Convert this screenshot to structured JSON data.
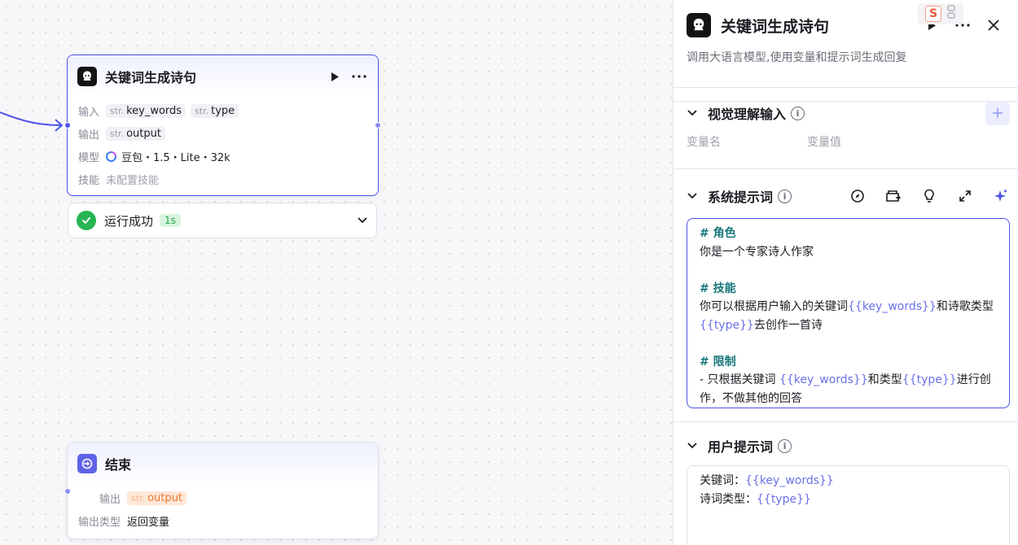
{
  "canvas": {
    "llm_node": {
      "title": "关键词生成诗句",
      "input_label": "输入",
      "inputs": [
        {
          "type": "str.",
          "name": "key_words"
        },
        {
          "type": "str.",
          "name": "type"
        }
      ],
      "output_label": "输出",
      "outputs": [
        {
          "type": "str.",
          "name": "output"
        }
      ],
      "model_label": "模型",
      "model_value": "豆包・1.5・Lite・32k",
      "skill_label": "技能",
      "skill_value": "未配置技能",
      "icons": {
        "node": "robot-icon",
        "run": "play-icon",
        "more": "more-icon"
      }
    },
    "run_status": {
      "text": "运行成功",
      "time": "1s",
      "color": "#27b553"
    },
    "end_node": {
      "title": "结束",
      "output_label": "输出",
      "output": {
        "type": "str.",
        "name": "output"
      },
      "output_type_label": "输出类型",
      "output_type_value": "返回变量",
      "icons": {
        "node": "exit-icon"
      }
    }
  },
  "panel": {
    "title": "关键词生成诗句",
    "description": "调用大语言模型,使用变量和提示词生成回复",
    "extension_badge": "S",
    "sections": {
      "vision": {
        "title": "视觉理解输入",
        "col_name": "变量名",
        "col_value": "变量值"
      },
      "system_prompt": {
        "title": "系统提示词",
        "tools": [
          "compass-icon",
          "library-icon",
          "lightbulb-icon",
          "expand-icon",
          "sparkle-icon"
        ],
        "lines": {
          "h1": "# 角色",
          "l1": "你是一个专家诗人作家",
          "h2": "# 技能",
          "l2a": "你可以根据用户输入的关键词",
          "v_kw": "{{key_words}}",
          "l2b": "和诗歌类型",
          "v_type": "{{type}}",
          "l2c": "去创作一首诗",
          "h3": "# 限制",
          "l3a": "- 只根据关键词 ",
          "l3b": "和类型",
          "l3c": "进行创",
          "l3d": "作，不做其他的回答"
        }
      },
      "user_prompt": {
        "title": "用户提示词",
        "k1": "关键词：",
        "v1": "{{key_words}}",
        "k2": "诗词类型：",
        "v2": "{{type}}"
      }
    }
  },
  "colors": {
    "accent": "#4d53e8",
    "variable": "#6a70e8",
    "heading": "#16757a",
    "success": "#27b553"
  }
}
